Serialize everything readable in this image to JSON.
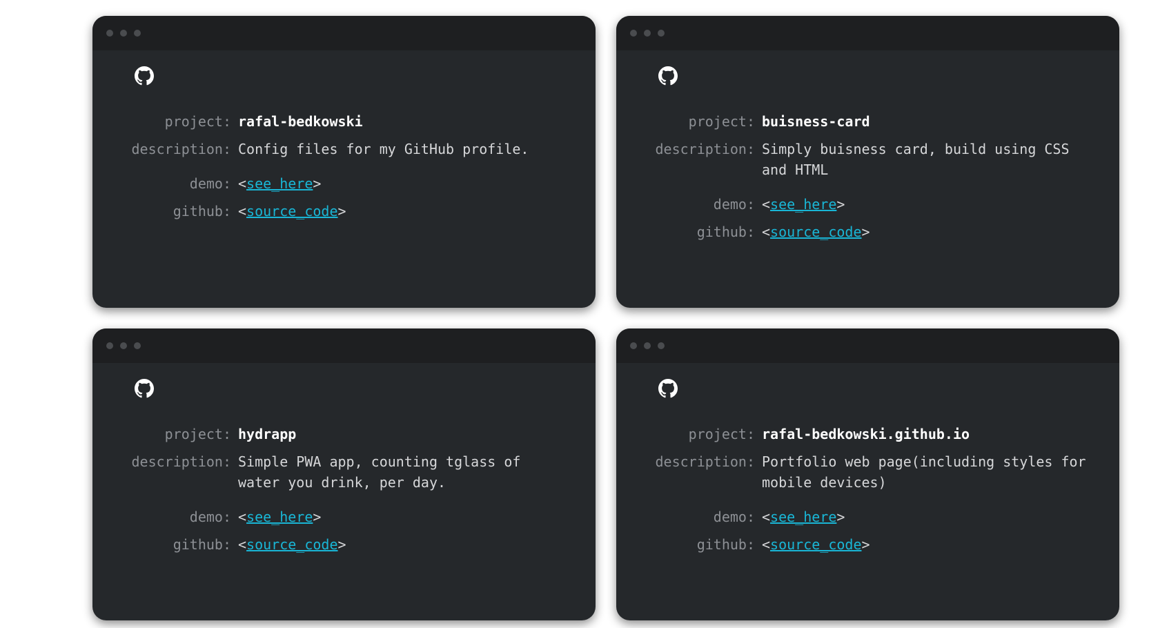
{
  "labels": {
    "project": "project:",
    "description": "description:",
    "demo": "demo:",
    "github": "github:"
  },
  "link_open": "<",
  "link_close": ">",
  "icon": "github-icon",
  "colors": {
    "card_bg": "#25282b",
    "titlebar_bg": "#1e1f21",
    "label": "#8d9095",
    "link": "#19b6d6"
  },
  "cards": [
    {
      "project": "rafal-bedkowski",
      "description": "Config files for my GitHub profile.",
      "demo_link": "see_here",
      "github_link": "source_code"
    },
    {
      "project": "buisness-card",
      "description": "Simply buisness card, build using CSS and HTML",
      "demo_link": "see_here",
      "github_link": "source_code"
    },
    {
      "project": "hydrapp",
      "description": "Simple PWA app, counting tglass of water you drink, per day.",
      "demo_link": "see_here",
      "github_link": "source_code"
    },
    {
      "project": "rafal-bedkowski.github.io",
      "description": "Portfolio web page(including styles for mobile devices)",
      "demo_link": "see_here",
      "github_link": "source_code"
    }
  ]
}
